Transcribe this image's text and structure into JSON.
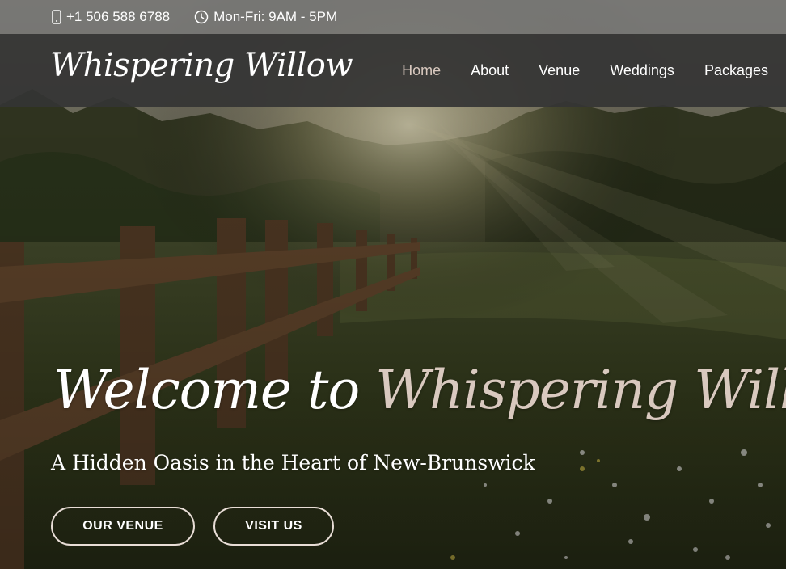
{
  "topbar": {
    "phone": "+1 506 588 6788",
    "phone_icon": "mobile-phone-icon",
    "hours": "Mon-Fri: 9AM - 5PM",
    "hours_icon": "clock-icon"
  },
  "header": {
    "logo": "Whispering Willow",
    "nav": [
      {
        "label": "Home",
        "active": true
      },
      {
        "label": "About",
        "active": false
      },
      {
        "label": "Venue",
        "active": false
      },
      {
        "label": "Weddings",
        "active": false
      },
      {
        "label": "Packages",
        "active": false
      }
    ]
  },
  "hero": {
    "title_part1": "Welcome to",
    "title_part2": "Whispering Willow",
    "subtitle": "A Hidden Oasis in the Heart of New-Brunswick",
    "buttons": {
      "venue": "OUR VENUE",
      "visit": "VISIT US"
    }
  },
  "colors": {
    "accent": "#d9c9bf",
    "nav_bg": "#343434",
    "topbar_bg": "#787878"
  }
}
